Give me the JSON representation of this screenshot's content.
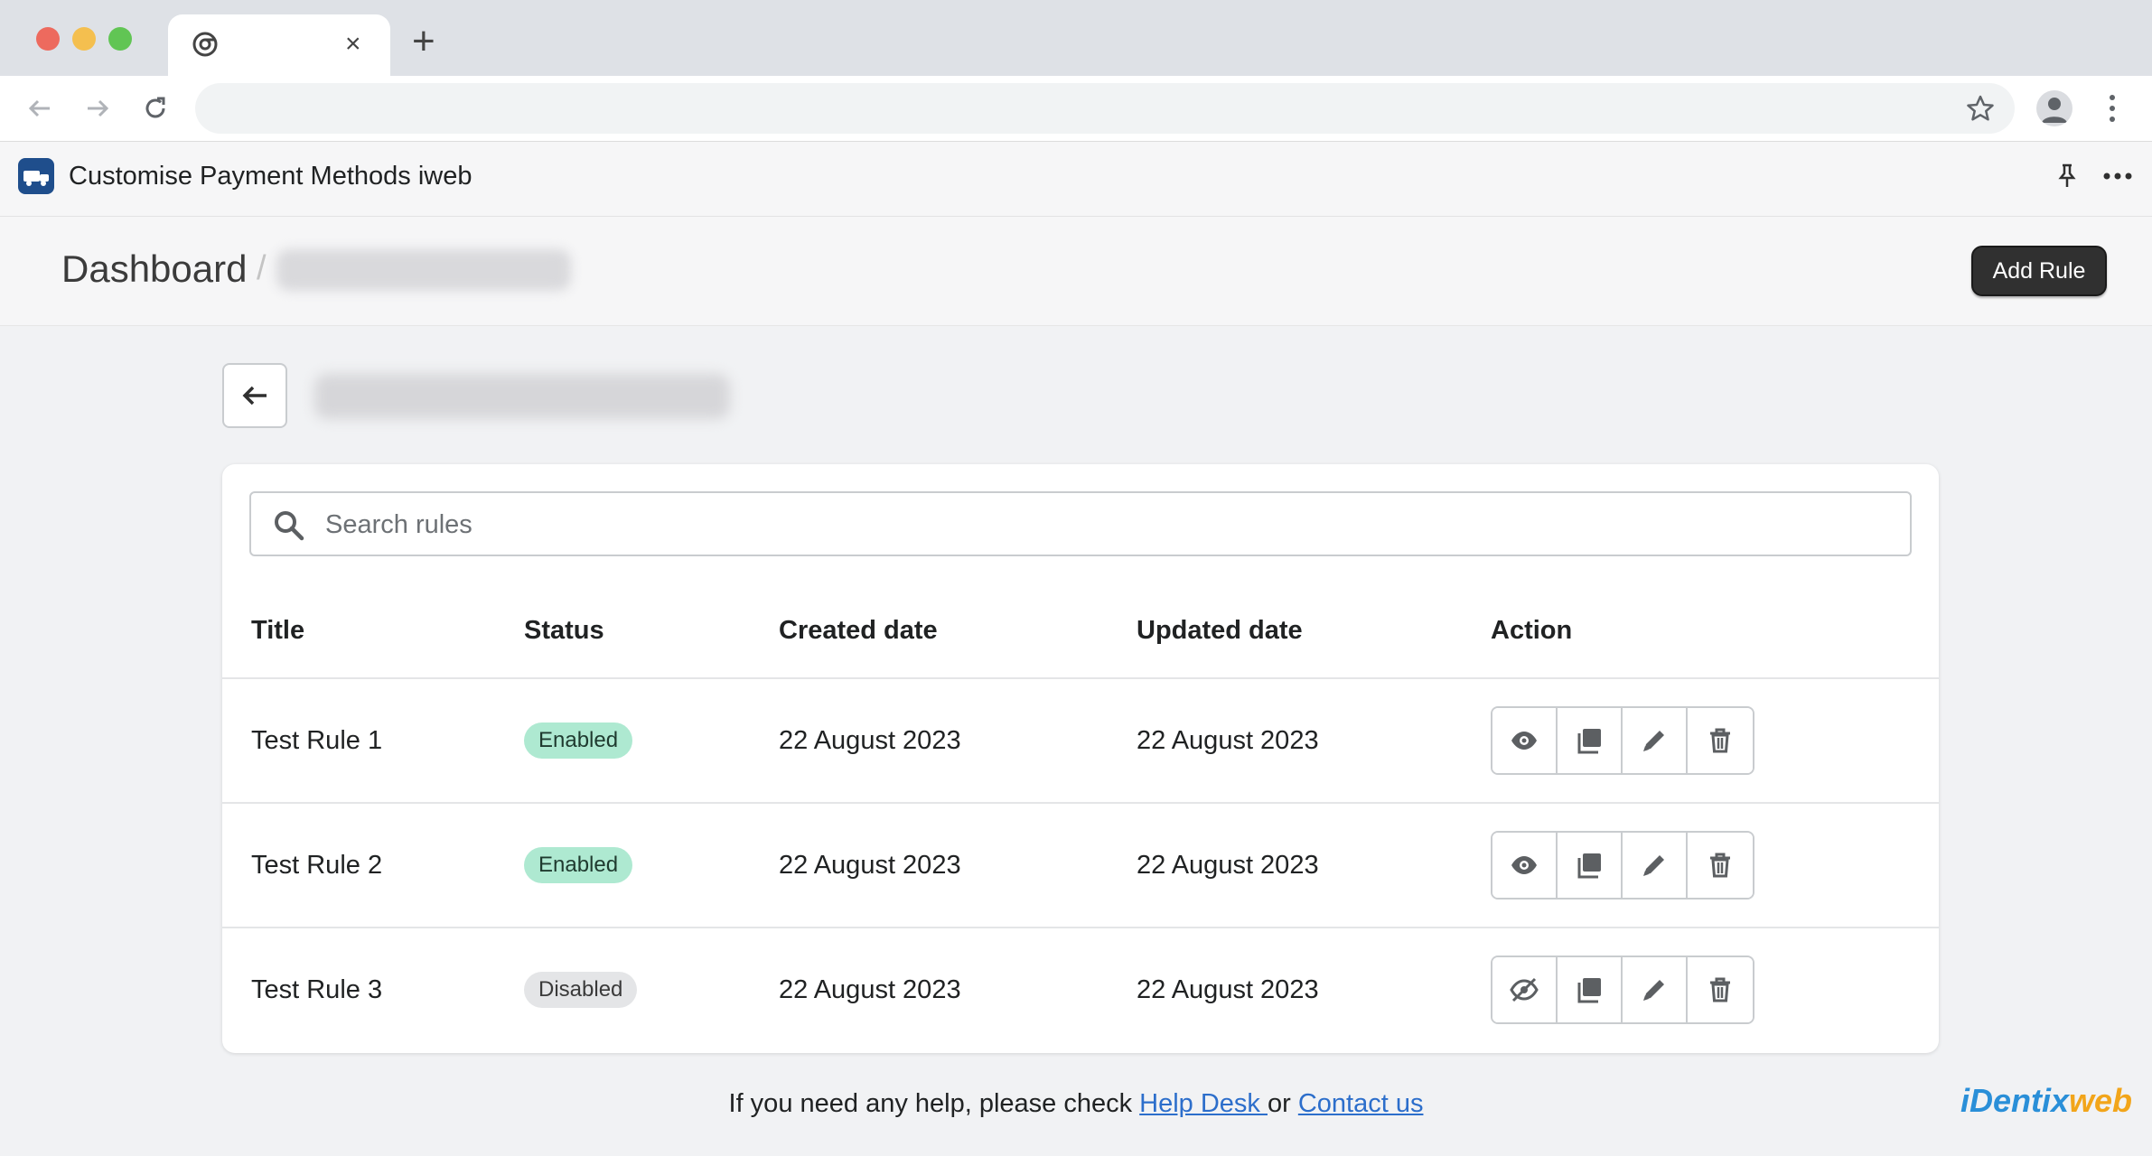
{
  "browser": {
    "tab_close": "×",
    "new_tab": "+"
  },
  "app": {
    "title": "Customise Payment Methods iweb"
  },
  "page_header": {
    "breadcrumb_root": "Dashboard",
    "breadcrumb_sep": "/",
    "add_rule_label": "Add Rule"
  },
  "search": {
    "placeholder": "Search rules",
    "value": ""
  },
  "table": {
    "headers": [
      "Title",
      "Status",
      "Created date",
      "Updated date",
      "Action"
    ],
    "rows": [
      {
        "title": "Test Rule 1",
        "status": "Enabled",
        "created": "22 August 2023",
        "updated": "22 August 2023"
      },
      {
        "title": "Test Rule 2",
        "status": "Enabled",
        "created": "22 August 2023",
        "updated": "22 August 2023"
      },
      {
        "title": "Test Rule 3",
        "status": "Disabled",
        "created": "22 August 2023",
        "updated": "22 August 2023"
      }
    ]
  },
  "footer": {
    "text": "If you need any help, please check ",
    "help_desk": "Help Desk ",
    "or": "or ",
    "contact_us": "Contact us"
  },
  "brand": {
    "part1": "iDentix",
    "part2": "web"
  },
  "colors": {
    "enabled_badge": "#aee9d1",
    "disabled_badge": "#e4e5e7",
    "primary_button": "#303030",
    "link": "#2c6ecb"
  }
}
